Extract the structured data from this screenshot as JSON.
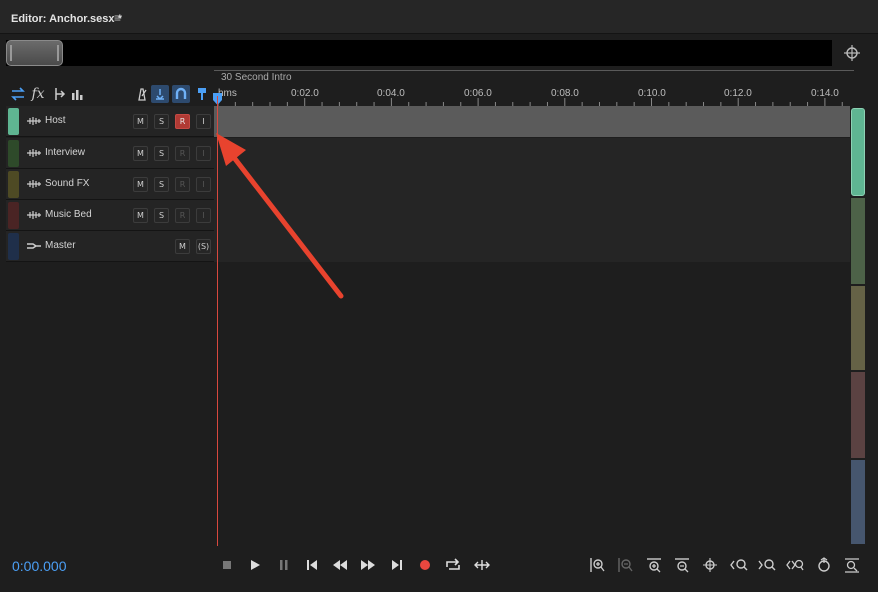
{
  "panel": {
    "title": "Editor: Anchor.sesx *",
    "menu_icon": "hamburger-menu-icon"
  },
  "ruler": {
    "marker": "30 Second Intro",
    "labels": [
      "hms",
      "0:02.0",
      "0:04.0",
      "0:06.0",
      "0:08.0",
      "0:10.0",
      "0:12.0",
      "0:14.0"
    ]
  },
  "toolbar": {
    "icons": [
      "input-output-icon",
      "fx-icon",
      "sends-icon",
      "eq-icon",
      "metronome-icon",
      "snap-icon",
      "magnet-icon",
      "marker-icon"
    ]
  },
  "tracks": [
    {
      "name": "Host",
      "color": "#5fb592",
      "selected": true,
      "armed": true,
      "buttons": [
        "M",
        "S",
        "R",
        "I"
      ]
    },
    {
      "name": "Interview",
      "color": "#2e4a2a",
      "selected": false,
      "armed": false,
      "buttons": [
        "M",
        "S",
        "R",
        "I"
      ]
    },
    {
      "name": "Sound FX",
      "color": "#4e4a24",
      "selected": false,
      "armed": false,
      "buttons": [
        "M",
        "S",
        "R",
        "I"
      ]
    },
    {
      "name": "Music Bed",
      "color": "#4a2424",
      "selected": false,
      "armed": false,
      "buttons": [
        "M",
        "S",
        "R",
        "I"
      ]
    },
    {
      "name": "Master",
      "color": "#1f2f4a",
      "selected": false,
      "armed": false,
      "buttons": [
        "M",
        "(S)"
      ]
    }
  ],
  "transport": {
    "time": "0:00.000",
    "controls": [
      "stop-icon",
      "play-icon",
      "pause-icon",
      "go-to-start-icon",
      "rewind-icon",
      "fast-forward-icon",
      "go-to-end-icon",
      "record-icon",
      "loop-icon",
      "skip-selection-icon"
    ],
    "zoom": [
      "zoom-in-amplitude-icon",
      "zoom-out-amplitude-icon",
      "zoom-in-time-icon",
      "zoom-out-time-icon",
      "zoom-reset-icon",
      "zoom-in-left-icon",
      "zoom-in-right-icon",
      "zoom-selection-icon",
      "zoom-tracks-icon",
      "zoom-out-full-icon"
    ]
  },
  "colors": {
    "accent": "#4b9ff5",
    "playhead": "#d8483e",
    "record": "#e8473f",
    "annotation": "#e8432e"
  }
}
